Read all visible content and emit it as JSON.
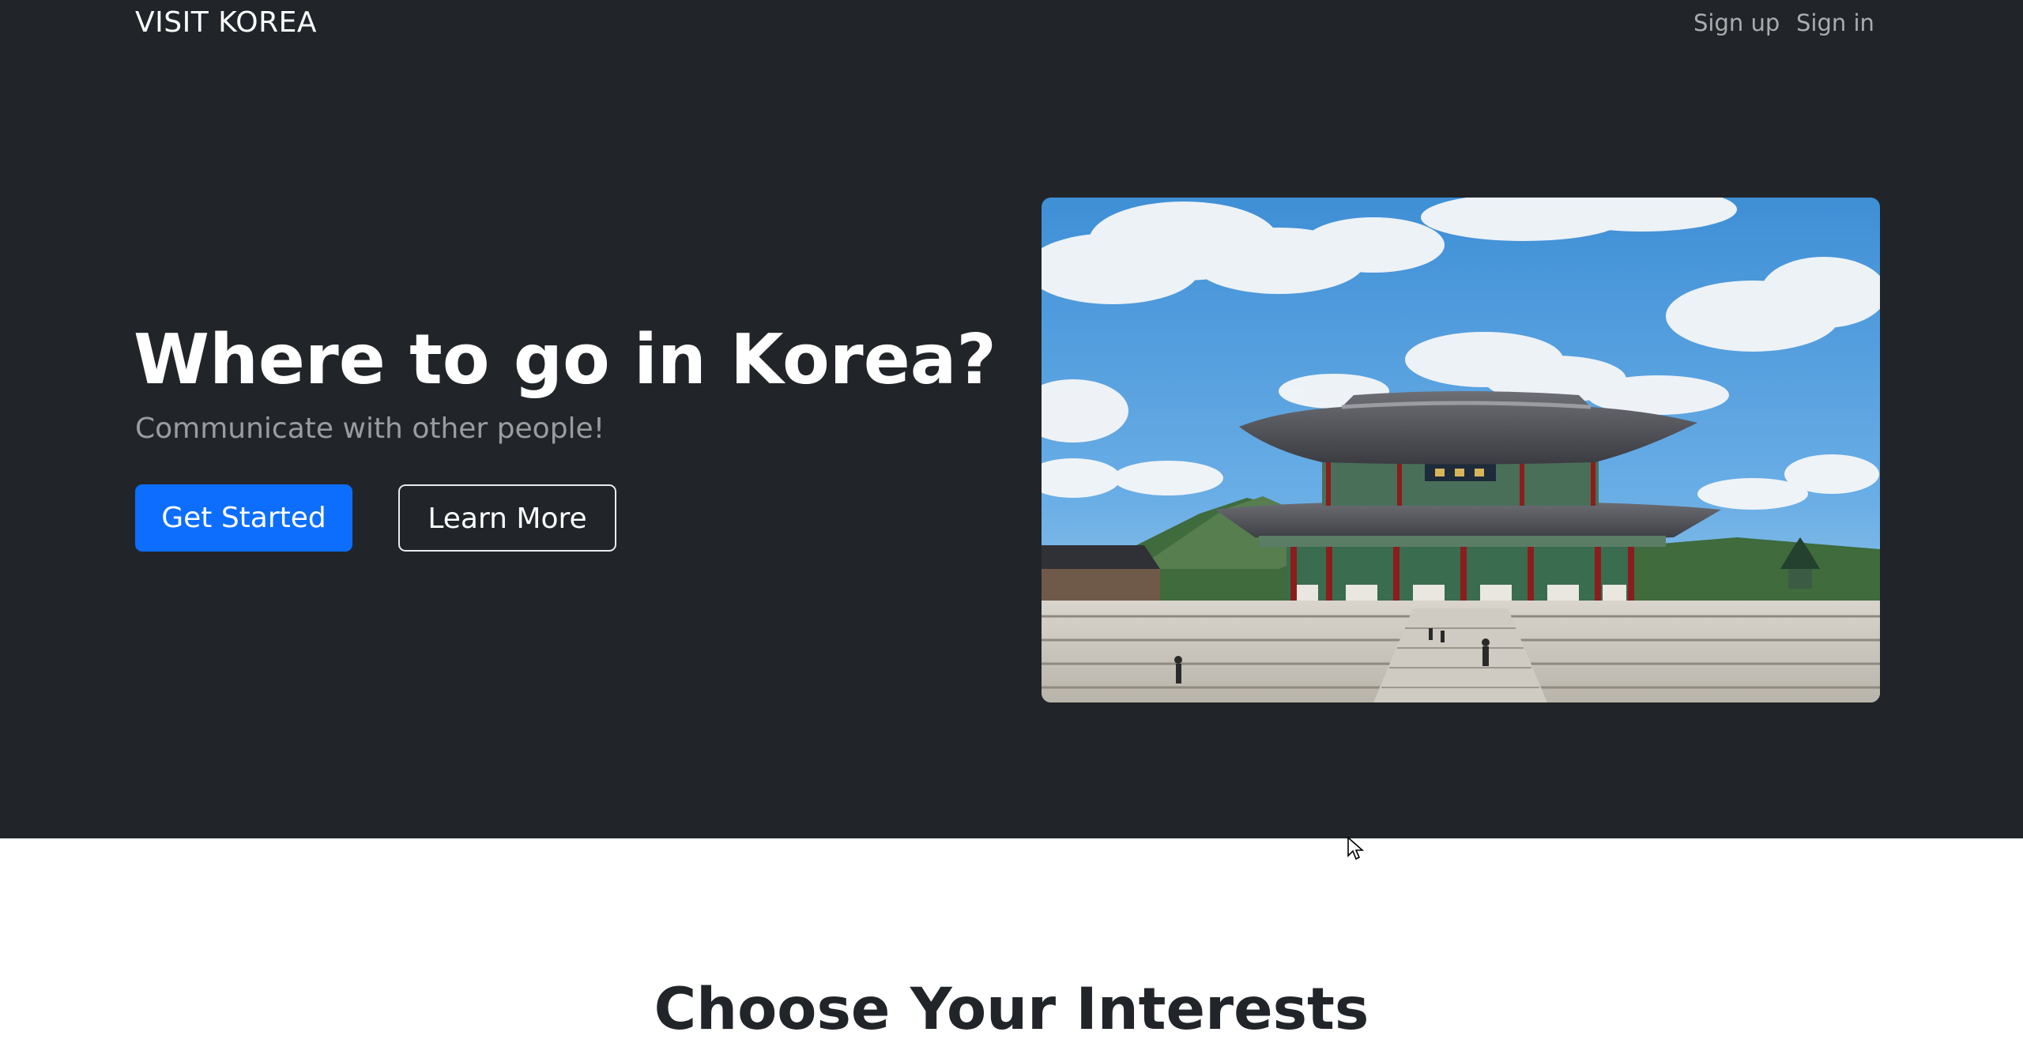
{
  "navbar": {
    "brand": "VISIT KOREA",
    "links": [
      {
        "label": "Sign up"
      },
      {
        "label": "Sign in"
      }
    ]
  },
  "hero": {
    "title": "Where to go in Korea?",
    "subtitle": "Communicate with other people!",
    "primary_button": "Get Started",
    "secondary_button": "Learn More",
    "image_subject": "gyeongbokgung-palace"
  },
  "interests": {
    "title": "Choose Your Interests"
  },
  "colors": {
    "hero_background": "#212529",
    "primary": "#0d6efd",
    "page_background": "#ffffff",
    "heading_text": "#212529"
  }
}
